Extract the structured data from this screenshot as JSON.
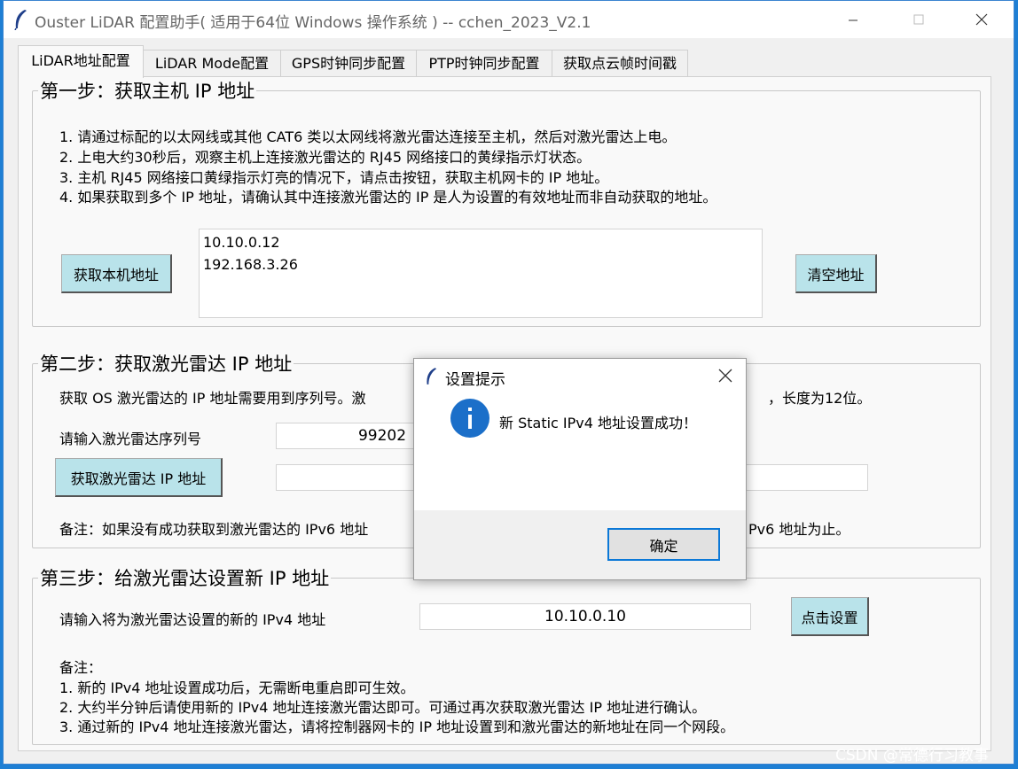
{
  "window": {
    "title": "Ouster LiDAR 配置助手( 适用于64位 Windows 操作系统 ) -- cchen_2023_V2.1",
    "app_icon": "feather-icon",
    "controls": [
      "minimize-icon",
      "maximize-icon",
      "close-icon"
    ]
  },
  "tabs": [
    {
      "label": "LiDAR地址配置",
      "active": true
    },
    {
      "label": "LiDAR Mode配置",
      "active": false
    },
    {
      "label": "GPS时钟同步配置",
      "active": false
    },
    {
      "label": "PTP时钟同步配置",
      "active": false
    },
    {
      "label": "获取点云帧时间戳",
      "active": false
    }
  ],
  "step1": {
    "title": "第一步：获取主机 IP 地址",
    "lines": [
      "1. 请通过标配的以太网线或其他 CAT6 类以太网线将激光雷达连接至主机，然后对激光雷达上电。",
      "2. 上电大约30秒后，观察主机上连接激光雷达的 RJ45 网络接口的黄绿指示灯状态。",
      "3. 主机 RJ45 网络接口黄绿指示灯亮的情况下，请点击按钮，获取主机网卡的 IP 地址。",
      "4. 如果获取到多个 IP 地址，请确认其中连接激光雷达的 IP 是人为设置的有效地址而非自动获取的地址。"
    ],
    "get_button": "获取本机地址",
    "clear_button": "清空地址",
    "addresses": [
      "10.10.0.12",
      "192.168.3.26"
    ]
  },
  "step2": {
    "title": "第二步：获取激光雷达 IP 地址",
    "desc_left": "获取 OS 激光雷达的 IP 地址需要用到序列号。激",
    "desc_right": "，长度为12位。",
    "serial_label": "请输入激光雷达序列号",
    "serial_value": "99202",
    "get_button": "获取激光雷达 IP 地址",
    "ip_result": "",
    "note_left": "备注：如果没有成功获取到激光雷达的 IPv6 地址",
    "note_right": "Pv6 地址为止。"
  },
  "step3": {
    "title": "第三步：给激光雷达设置新 IP 地址",
    "input_label": "请输入将为激光雷达设置的新的 IPv4 地址",
    "input_value": "10.10.0.10",
    "set_button": "点击设置",
    "notes": [
      "备注：",
      "1. 新的 IPv4 地址设置成功后，无需断电重启即可生效。",
      "2. 大约半分钟后请使用新的 IPv4 地址连接激光雷达即可。可通过再次获取激光雷达 IP 地址进行确认。",
      "3. 通过新的 IPv4 地址连接激光雷达，请将控制器网卡的 IP 地址设置到和激光雷达的新地址在同一个网段。"
    ]
  },
  "dialog": {
    "title": "设置提示",
    "message": "新 Static IPv4 地址设置成功！",
    "ok_button": "确定",
    "icon": "info-icon"
  },
  "watermark": "CSDN @常德行习教事",
  "colors": {
    "desktop": "#1e7fd4",
    "button_bg": "#b9e3ea",
    "dialog_ok_border": "#0b78d7",
    "info_icon": "#1b6fc9"
  }
}
